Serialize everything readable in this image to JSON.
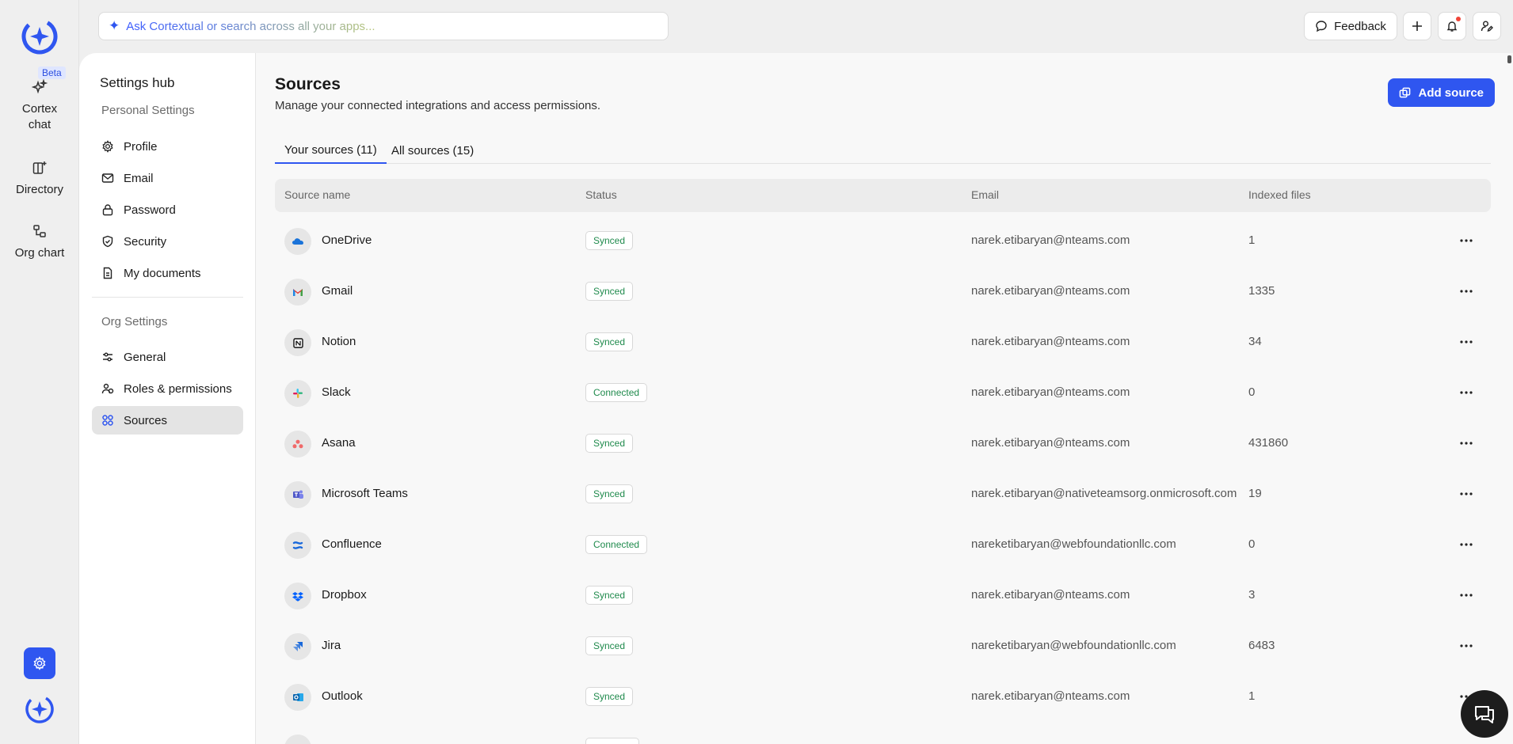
{
  "rail": {
    "items": [
      {
        "label": "Cortex chat",
        "icon": "sparkle-icon",
        "badge": "Beta"
      },
      {
        "label": "Directory",
        "icon": "directory-icon"
      },
      {
        "label": "Org chart",
        "icon": "org-chart-icon"
      }
    ]
  },
  "search": {
    "placeholder": "Ask Cortextual or search across all your apps..."
  },
  "header": {
    "feedback_label": "Feedback"
  },
  "settings_nav": {
    "title": "Settings hub",
    "personal_section": "Personal Settings",
    "personal_items": [
      {
        "label": "Profile",
        "icon": "gear-icon"
      },
      {
        "label": "Email",
        "icon": "mail-icon"
      },
      {
        "label": "Password",
        "icon": "lock-icon"
      },
      {
        "label": "Security",
        "icon": "shield-icon"
      },
      {
        "label": "My documents",
        "icon": "document-icon"
      }
    ],
    "org_section": "Org Settings",
    "org_items": [
      {
        "label": "General",
        "icon": "sliders-icon"
      },
      {
        "label": "Roles & permissions",
        "icon": "users-icon"
      },
      {
        "label": "Sources",
        "icon": "grid-icon",
        "active": true
      }
    ]
  },
  "page": {
    "title": "Sources",
    "subtitle": "Manage your connected integrations and access permissions.",
    "add_button": "Add source",
    "tabs": [
      {
        "label": "Your sources (11)",
        "active": true
      },
      {
        "label": "All sources (15)",
        "active": false
      }
    ]
  },
  "table": {
    "columns": [
      "Source name",
      "Status",
      "Email",
      "Indexed files"
    ],
    "rows": [
      {
        "name": "OneDrive",
        "status": "Synced",
        "email": "narek.etibaryan@nteams.com",
        "files": "1",
        "icon": "onedrive-icon"
      },
      {
        "name": "Gmail",
        "status": "Synced",
        "email": "narek.etibaryan@nteams.com",
        "files": "1335",
        "icon": "gmail-icon"
      },
      {
        "name": "Notion",
        "status": "Synced",
        "email": "narek.etibaryan@nteams.com",
        "files": "34",
        "icon": "notion-icon"
      },
      {
        "name": "Slack",
        "status": "Connected",
        "email": "narek.etibaryan@nteams.com",
        "files": "0",
        "icon": "slack-icon"
      },
      {
        "name": "Asana",
        "status": "Synced",
        "email": "narek.etibaryan@nteams.com",
        "files": "431860",
        "icon": "asana-icon"
      },
      {
        "name": "Microsoft Teams",
        "status": "Synced",
        "email": "narek.etibaryan@nativeteamsorg.onmicrosoft.com",
        "files": "19",
        "icon": "teams-icon"
      },
      {
        "name": "Confluence",
        "status": "Connected",
        "email": "nareketibaryan@webfoundationllc.com",
        "files": "0",
        "icon": "confluence-icon"
      },
      {
        "name": "Dropbox",
        "status": "Synced",
        "email": "narek.etibaryan@nteams.com",
        "files": "3",
        "icon": "dropbox-icon"
      },
      {
        "name": "Jira",
        "status": "Synced",
        "email": "nareketibaryan@webfoundationllc.com",
        "files": "6483",
        "icon": "jira-icon"
      },
      {
        "name": "Outlook",
        "status": "Synced",
        "email": "narek.etibaryan@nteams.com",
        "files": "1",
        "icon": "outlook-icon"
      }
    ]
  },
  "colors": {
    "accent": "#2f56f0",
    "status_text": "#1f8a4c",
    "notification": "#f04438"
  }
}
